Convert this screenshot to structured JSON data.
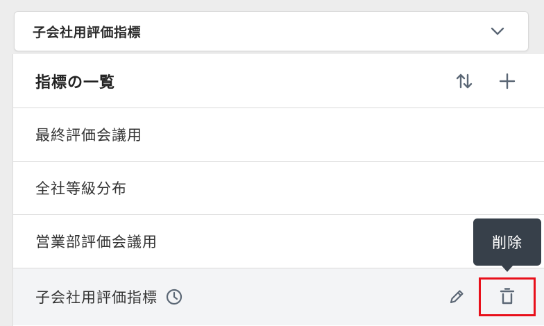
{
  "selector": {
    "value": "子会社用評価指標",
    "icon": "chevron-down-icon"
  },
  "panel": {
    "title": "指標の一覧",
    "actions": {
      "sort_icon": "sort-arrows-icon",
      "add_icon": "plus-icon"
    },
    "items": [
      {
        "label": "最終評価会議用"
      },
      {
        "label": "全社等級分布"
      },
      {
        "label": "営業部評価会議用"
      },
      {
        "label": "子会社用評価指標",
        "status_icon": "clock-icon",
        "edit_icon": "pencil-icon",
        "delete_icon": "trash-icon"
      }
    ]
  },
  "tooltip": {
    "text": "削除"
  },
  "colors": {
    "highlight_border": "#e8101b",
    "tooltip_bg": "#37404a",
    "icon": "#5b6775",
    "active_row": "#f3f4f6"
  }
}
